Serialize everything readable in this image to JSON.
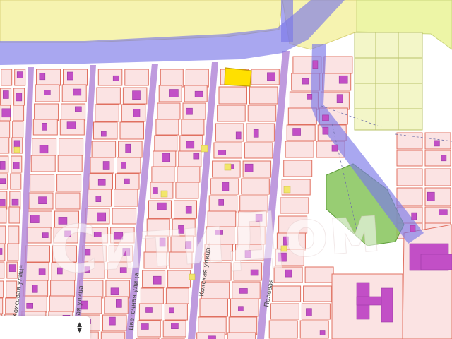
{
  "colors": {
    "background": "#ffffff",
    "plot_fill": "#fbe3e3",
    "plot_border": "#e07060",
    "field_yellow": "#f6f3b0",
    "field_yellowgreen": "#edf5a6",
    "road_blue": "#7b78e8",
    "street_purple": "#b48ad8",
    "building_magenta": "#c24fc6",
    "highlight_plot": "#ffe000",
    "park_green": "#86c45a"
  },
  "streets": [
    {
      "name": "Кохсовая улица"
    },
    {
      "name": "Зеленая улица"
    },
    {
      "name": "Цветочная улица"
    },
    {
      "name": "Кокская улица"
    },
    {
      "name": "Полевая"
    }
  ],
  "watermark": {
    "text": "СитиДом"
  },
  "zoom_control": {
    "up_icon": "chevron-up-icon",
    "down_icon": "chevron-down-icon"
  }
}
